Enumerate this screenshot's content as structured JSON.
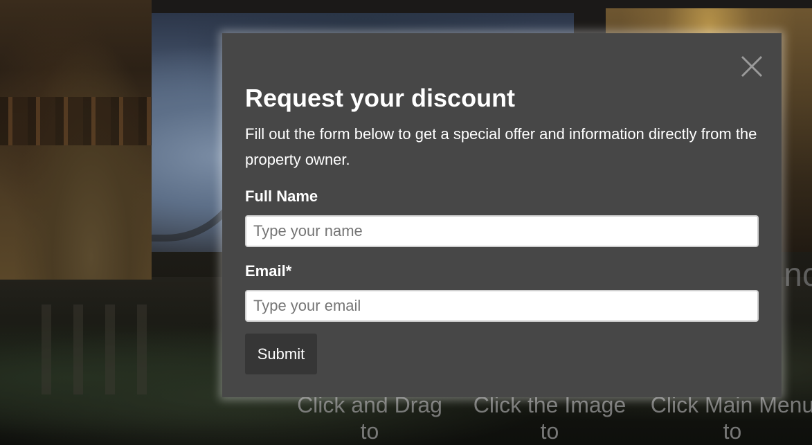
{
  "modal": {
    "title": "Request your discount",
    "description": "Fill out the form below to get a special offer and information directly from the property owner.",
    "close_icon": "close-icon",
    "fields": {
      "name": {
        "label": "Full Name",
        "placeholder": "Type your name",
        "value": ""
      },
      "email": {
        "label": "Email*",
        "placeholder": "Type your email",
        "value": ""
      }
    },
    "submit_label": "Submit"
  },
  "background": {
    "hints": [
      {
        "line1": "Click and Drag",
        "line2": "to"
      },
      {
        "line1": "Click the Image",
        "line2": "to"
      },
      {
        "line1": "Click Main Menu",
        "line2": "to"
      }
    ],
    "partial_text": "nc"
  },
  "colors": {
    "modal_bg": "#474747",
    "submit_bg": "#363636",
    "text": "#ffffff"
  }
}
